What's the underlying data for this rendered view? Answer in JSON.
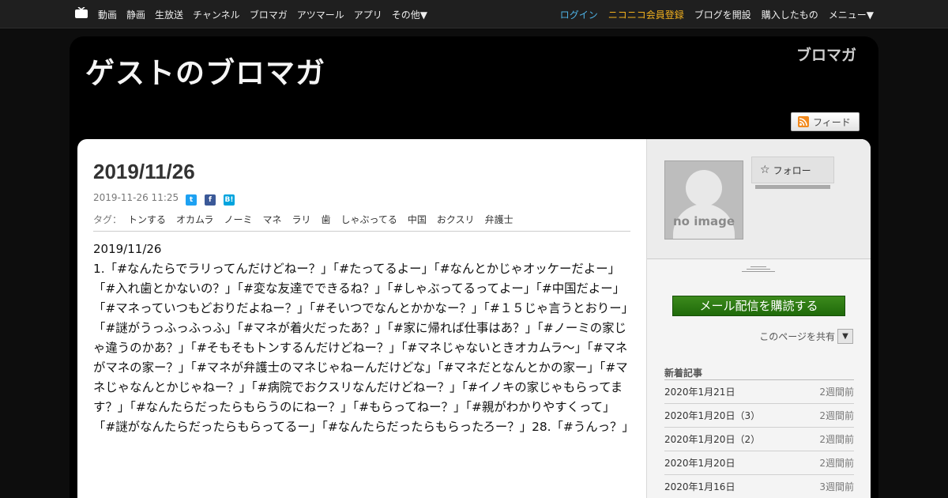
{
  "nav": {
    "left": [
      "動画",
      "静画",
      "生放送",
      "チャンネル",
      "ブロマガ",
      "アツマール",
      "アプリ",
      "その他▼"
    ],
    "login": "ログイン",
    "register": "ニコニコ会員登録",
    "open_blog": "ブログを開設",
    "purchased": "購入したもの",
    "menu": "メニュー▼"
  },
  "header": {
    "blog_title": "ゲストのブロマガ",
    "logo_text": "ブロマガ",
    "feed_label": "フィード"
  },
  "article": {
    "title": "2019/11/26",
    "datetime": "2019-11-26 11:25",
    "share_icons": [
      "twitter-icon",
      "facebook-icon",
      "hatena-icon"
    ],
    "tag_label": "タグ：",
    "tags": [
      "トンする",
      "オカムラ",
      "ノーミ",
      "マネ",
      "ラリ",
      "歯",
      "しゃぶってる",
      "中国",
      "おクスリ",
      "弁護士"
    ],
    "body_date": "2019/11/26",
    "body": "1.「#なんたらでラリってんだけどねー？」「#たってるよー」「#なんとかじゃオッケーだよー」「#入れ歯とかないの？」「#変な友達でできるね？」「#しゃぶってるってよー」「#中国だよー」「#マネっていつもどおりだよねー？」「#そいつでなんとかかなー？」「#１５じゃ言うとおりー」「#謎がうっふっふっふ」「#マネが着火だったあ？」「#家に帰れば仕事はあ？」「#ノーミの家じゃ違うのかあ？」「#そもそもトンするんだけどねー？」「#マネじゃないときオカムラ〜」「#マネがマネの家ー？」「#マネが弁護士のマネじゃねーんだけどな」「#マネだとなんとかの家ー」「#マネじゃなんとかじゃねー？」「#病院でおクスリなんだけどねー？」「#イノキの家じゃもらってます？」「#なんたらだったらもらうのにねー？」「#もらってねー？」「#親がわかりやすくって」「#謎がなんたらだったらもらってるー」「#なんたらだったらもらったろー？」28.「#うんっ？」"
  },
  "sidebar": {
    "no_image": "no image",
    "follow_label": "フォロー",
    "subscribe_label": "メール配信を購読する",
    "share_label": "このページを共有",
    "share_dropdown": "▼",
    "recent_title": "新着記事",
    "recent": [
      {
        "title": "2020年1月21日",
        "age": "2週間前"
      },
      {
        "title": "2020年1月20日（3）",
        "age": "2週間前"
      },
      {
        "title": "2020年1月20日（2）",
        "age": "2週間前"
      },
      {
        "title": "2020年1月20日",
        "age": "2週間前"
      },
      {
        "title": "2020年1月16日",
        "age": "3週間前"
      }
    ]
  }
}
